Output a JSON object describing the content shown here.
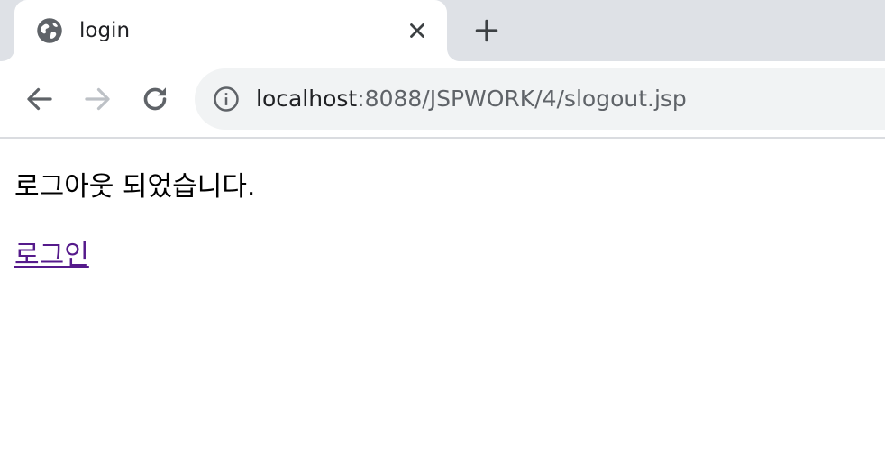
{
  "browser": {
    "tab": {
      "title": "login",
      "favicon": "globe-icon"
    },
    "new_tab_icon": "plus-icon",
    "close_icon": "close-icon",
    "navigation": {
      "back_icon": "arrow-left-icon",
      "forward_icon": "arrow-right-icon",
      "forward_enabled": false,
      "reload_icon": "reload-icon"
    },
    "address_bar": {
      "info_icon": "info-icon",
      "host": "localhost",
      "path": ":8088/JSPWORK/4/slogout.jsp"
    }
  },
  "page": {
    "message": "로그아웃 되었습니다.",
    "login_link": "로그인"
  },
  "colors": {
    "tabstrip": "#dee1e6",
    "omnibox": "#f1f3f4",
    "visited_link": "#551a8b",
    "icon": "#5f6368",
    "icon_disabled": "#bdc1c6"
  }
}
